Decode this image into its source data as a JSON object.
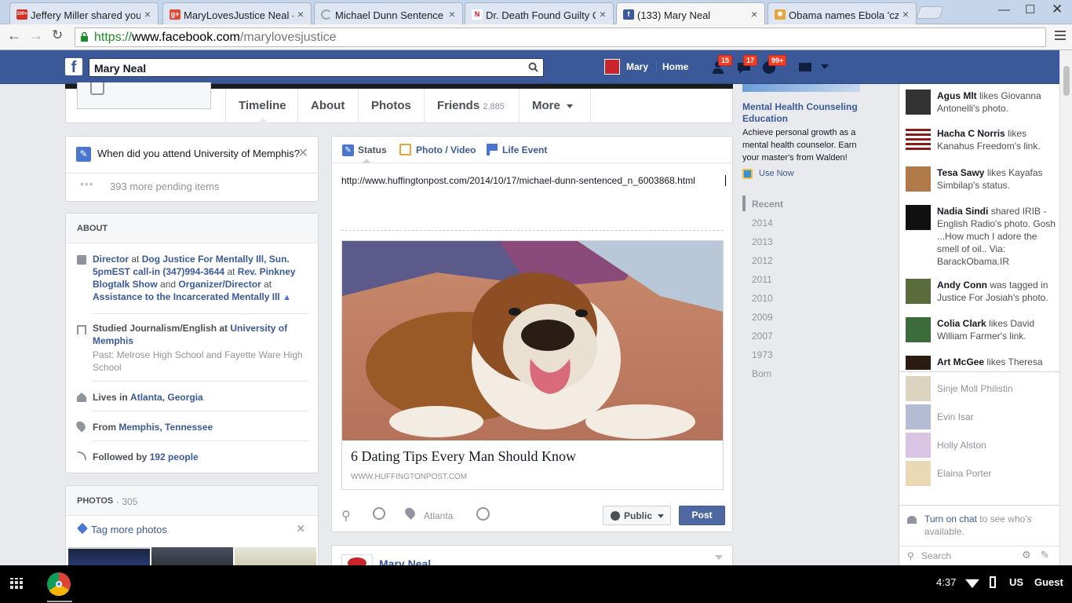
{
  "browser": {
    "tabs": [
      {
        "title": "Jeffery Miller shared you",
        "fav_color": "#d93025",
        "fav_text": "100+"
      },
      {
        "title": "MaryLovesJustice Neal -",
        "fav_color": "#dd4b39",
        "fav_text": "g+"
      },
      {
        "title": "Michael Dunn Sentence",
        "fav_color": "#9aa",
        "fav_text": ""
      },
      {
        "title": "Dr. Death Found Guilty O",
        "fav_color": "#e50914",
        "fav_text": "N"
      },
      {
        "title": "(133) Mary Neal",
        "fav_color": "#3b5998",
        "fav_text": "f"
      },
      {
        "title": "Obama names Ebola 'cz",
        "fav_color": "#e8a33d",
        "fav_text": "✹"
      }
    ],
    "url_scheme": "https://",
    "url_host": "www.facebook.com",
    "url_path": "/marylovesjustice"
  },
  "fb": {
    "search_value": "Mary Neal",
    "user_name": "Mary",
    "home_label": "Home",
    "badges": {
      "friends": "15",
      "messages": "17",
      "notifications": "99+"
    }
  },
  "profile_nav": {
    "tabs": [
      {
        "label": "Timeline"
      },
      {
        "label": "About"
      },
      {
        "label": "Photos"
      },
      {
        "label": "Friends",
        "count": "2,885"
      },
      {
        "label": "More"
      }
    ]
  },
  "question": {
    "text": "When did you attend University of Memphis?",
    "pending": "393 more pending items"
  },
  "about": {
    "heading": "ABOUT",
    "work_title": "Director",
    "at1": "at",
    "work_place": "Dog Justice For Mentally Ill, Sun. 5pmEST call-in (347)994-3644",
    "at2": "at",
    "work_place2": "Rev. Pinkney Blogtalk Show",
    "and": "and",
    "work_title2": "Organizer/Director",
    "at3": "at",
    "work_place3": "Assistance to the Incarcerated Mentally Ill",
    "studied": "Studied Journalism/English at",
    "school": "University of Memphis",
    "past": "Past: Melrose High School and Fayette Ware High School",
    "lives_prefix": "Lives in",
    "lives": "Atlanta, Georgia",
    "from_prefix": "From",
    "from": "Memphis, Tennessee",
    "followed_prefix": "Followed by",
    "followed": "192 people"
  },
  "photos": {
    "heading": "PHOTOS",
    "count": "· 305",
    "tag_label": "Tag more photos"
  },
  "composer": {
    "tab_status": "Status",
    "tab_photo": "Photo / Video",
    "tab_life": "Life Event",
    "text": "http://www.huffingtonpost.com/2014/10/17/michael-dunn-sentenced_n_6003868.html",
    "link_title": "6 Dating Tips Every Man Should Know",
    "link_domain": "WWW.HUFFINGTONPOST.COM",
    "location": "Atlanta",
    "audience": "Public",
    "post_label": "Post"
  },
  "next_post": {
    "author": "Mary Neal"
  },
  "ad": {
    "title": "Mental Health Counseling Education",
    "body": "Achieve personal growth as a mental health counselor. Earn your master's from Walden!",
    "cta": "Use Now"
  },
  "years": [
    "Recent",
    "2014",
    "2013",
    "2012",
    "2011",
    "2010",
    "2009",
    "2007",
    "1973",
    "Born"
  ],
  "ticker": [
    {
      "name": "Agus Mlt",
      "text": "likes Giovanna Antonelli's photo.",
      "color": "#333"
    },
    {
      "name": "Hacha C Norris",
      "text": "likes Kanahus Freedom's link.",
      "color": "#8a1c1c"
    },
    {
      "name": "Tesa Sawy",
      "text": "likes Kayafas Simbilap's status.",
      "color": "#b07a4a"
    },
    {
      "name": "Nadia Sindi",
      "text": "shared IRIB - English Radio's photo. Gosh ...How much I adore the smell of oil.. Via: BarackObama.IR",
      "color": "#111"
    },
    {
      "name": "Andy Conn",
      "text": "was tagged in Justice For Josiah's photo.",
      "color": "#5a6b3c"
    },
    {
      "name": "Colia Clark",
      "text": "likes David William Farmer's link.",
      "color": "#3c6b3c"
    },
    {
      "name": "Art McGee",
      "text": "likes Theresa",
      "color": "#2b1b10"
    }
  ],
  "chat": [
    {
      "name": "Sinje Moll Philistin",
      "color": "#b9a882"
    },
    {
      "name": "Evin Isar",
      "color": "#6a7aa8"
    },
    {
      "name": "Holly Alston",
      "color": "#b58ac8"
    },
    {
      "name": "Elaina Porter",
      "color": "#d6b36a"
    }
  ],
  "chat_footer": {
    "turn_on": "Turn on chat",
    "rest": "to see who's available.",
    "search": "Search"
  },
  "system": {
    "time": "4:37",
    "lang": "US",
    "user": "Guest"
  }
}
